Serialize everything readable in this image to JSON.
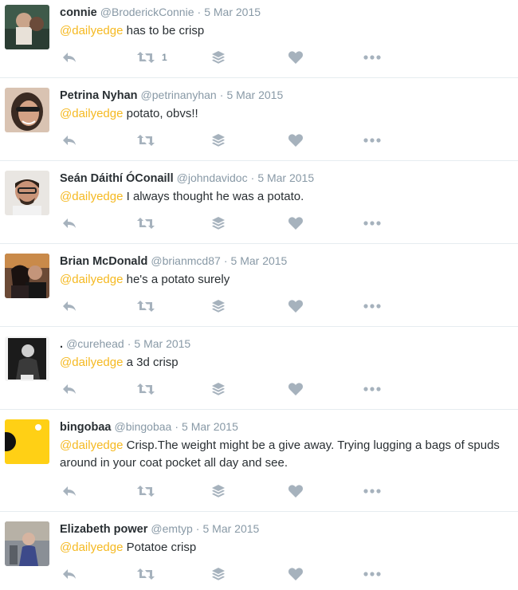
{
  "tweets": [
    {
      "name": "connie",
      "handle": "@BroderickConnie",
      "date": "5 Mar 2015",
      "mention": "@dailyedge",
      "text": " has to be crisp",
      "retweets": "1"
    },
    {
      "name": "Petrina Nyhan",
      "handle": "@petrinanyhan",
      "date": "5 Mar 2015",
      "mention": "@dailyedge",
      "text": " potato, obvs!!",
      "retweets": ""
    },
    {
      "name": "Seán Dáithí ÓConaill",
      "handle": "@johndavidoc",
      "date": "5 Mar 2015",
      "mention": "@dailyedge",
      "text": " I always thought he was a potato.",
      "retweets": ""
    },
    {
      "name": "Brian McDonald",
      "handle": "@brianmcd87",
      "date": "5 Mar 2015",
      "mention": "@dailyedge",
      "text": " he's a potato surely",
      "retweets": ""
    },
    {
      "name": ".",
      "handle": "@curehead",
      "date": "5 Mar 2015",
      "mention": "@dailyedge",
      "text": " a 3d crisp",
      "retweets": ""
    },
    {
      "name": "bingobaa",
      "handle": "@bingobaa",
      "date": "5 Mar 2015",
      "mention": "@dailyedge",
      "text": " Crisp.The weight might be a give away. Trying lugging a bags of spuds around in your coat pocket all day and see.",
      "retweets": ""
    },
    {
      "name": "Elizabeth power",
      "handle": "@emtyp",
      "date": "5 Mar 2015",
      "mention": "@dailyedge",
      "text": " Potatoe crisp",
      "retweets": ""
    }
  ],
  "separator": "·",
  "icons": [
    "reply-icon",
    "retweet-icon",
    "buffer-icon",
    "like-icon",
    "more-icon"
  ],
  "colors": {
    "mention": "#f5b921",
    "meta": "#8899a6",
    "icon": "#a6b2bd"
  }
}
